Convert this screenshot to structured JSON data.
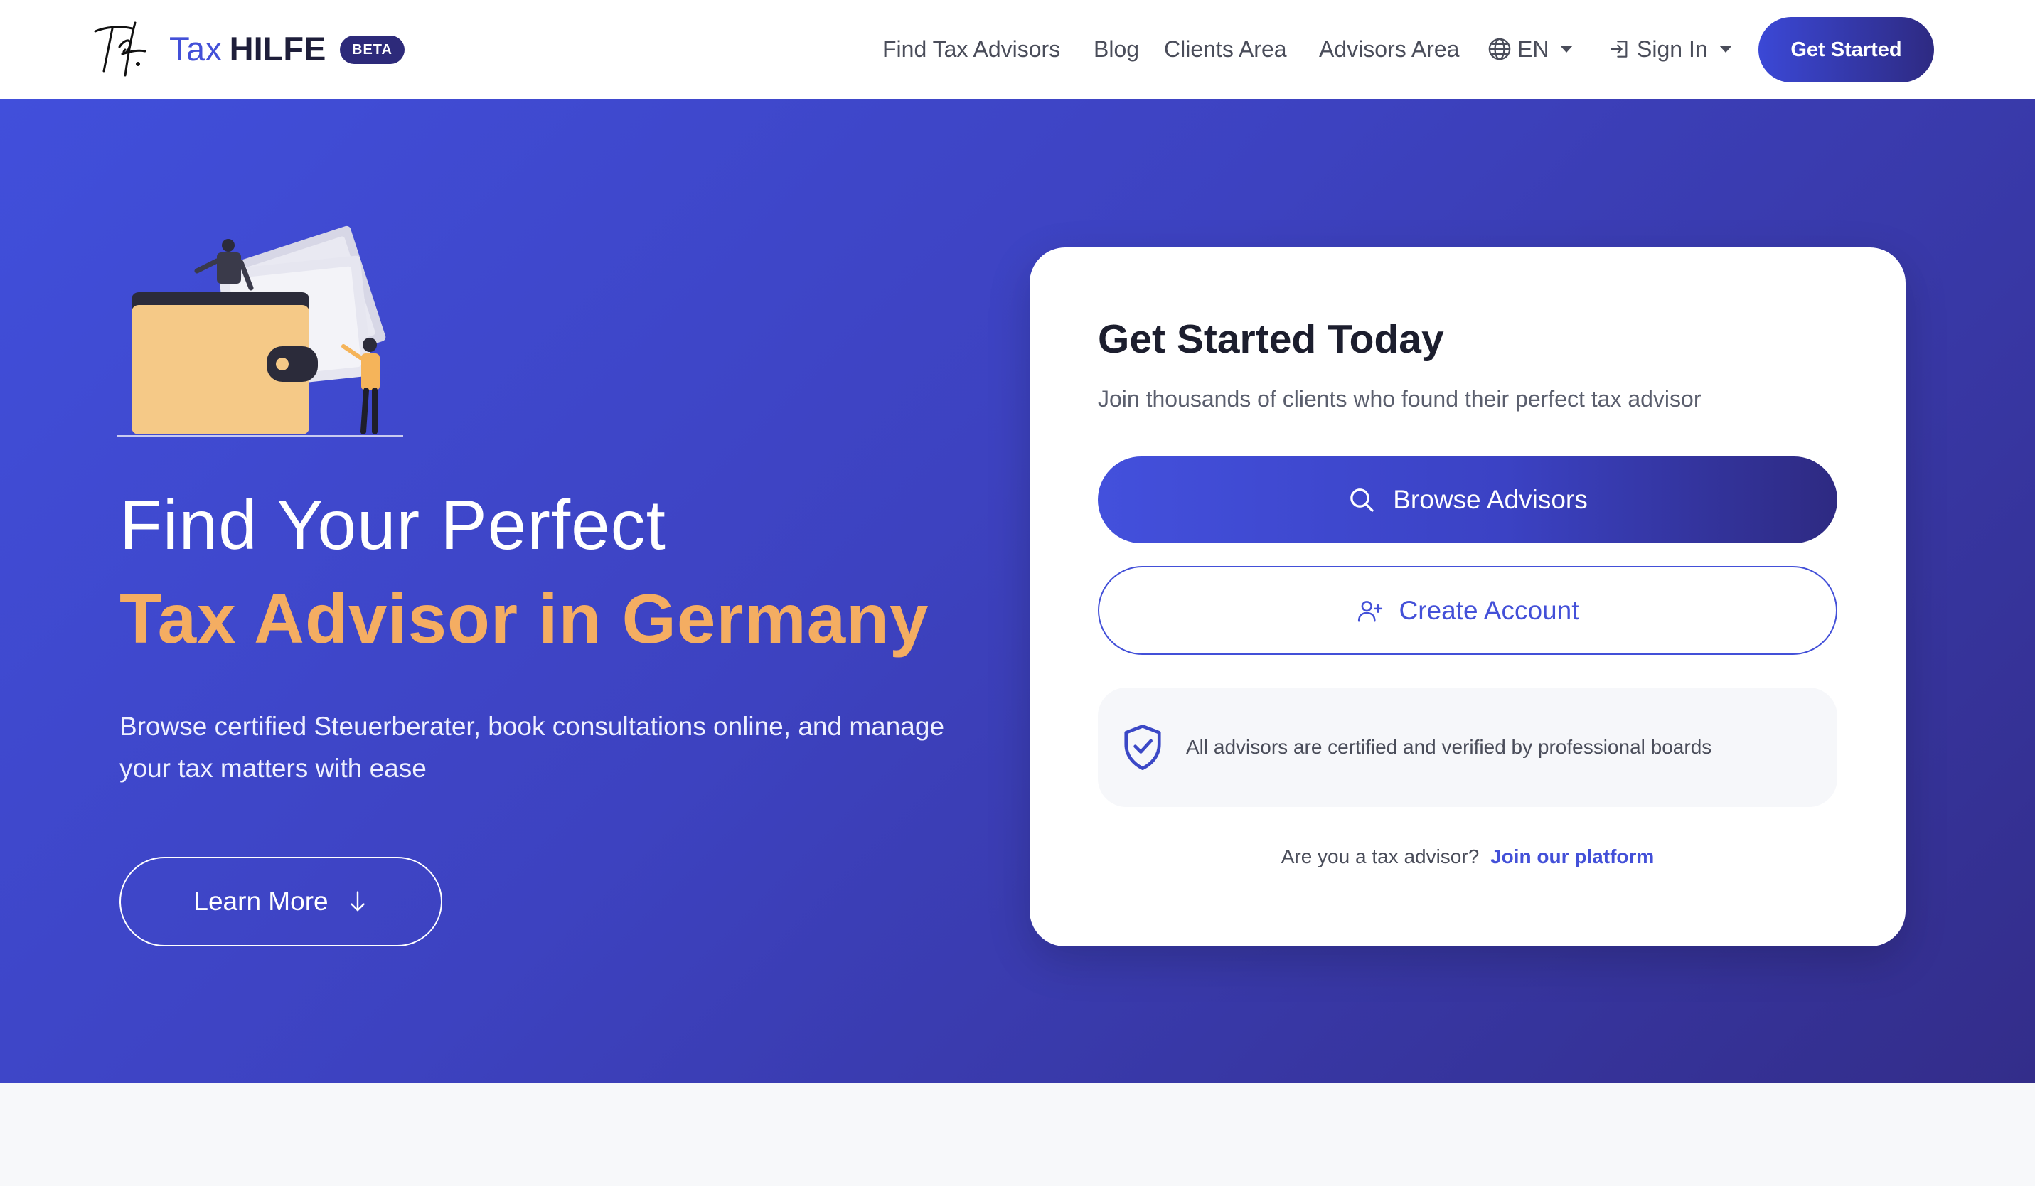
{
  "header": {
    "brand_tax": "Tax",
    "brand_hilfe": "HILFE",
    "beta_badge": "BETA",
    "nav": {
      "find_advisors": "Find Tax Advisors",
      "blog": "Blog",
      "clients_area": "Clients Area",
      "advisors_area": "Advisors Area",
      "language": "EN",
      "sign_in": "Sign In"
    },
    "cta": "Get Started",
    "icons": [
      "logo-signature-icon",
      "globe-icon",
      "sign-in-icon",
      "chevron-down-icon"
    ]
  },
  "hero": {
    "title_line1": "Find Your Perfect",
    "title_line2": "Tax Advisor in Germany",
    "subtitle": "Browse certified Steuerberater, book consultations online, and manage your tax matters with ease",
    "learn_more": "Learn More",
    "colors": {
      "accent": "#f4ad62",
      "gradient_start": "#414fdb",
      "gradient_end": "#332d8a"
    }
  },
  "card": {
    "title": "Get Started Today",
    "subtitle": "Join thousands of clients who found their perfect tax advisor",
    "browse_button": "Browse Advisors",
    "create_button": "Create Account",
    "verify_text": "All advisors are certified and verified by professional boards",
    "advisor_prompt": "Are you a tax advisor?",
    "advisor_link": "Join our platform",
    "icons": [
      "search-icon",
      "user-plus-icon",
      "shield-check-icon"
    ]
  }
}
